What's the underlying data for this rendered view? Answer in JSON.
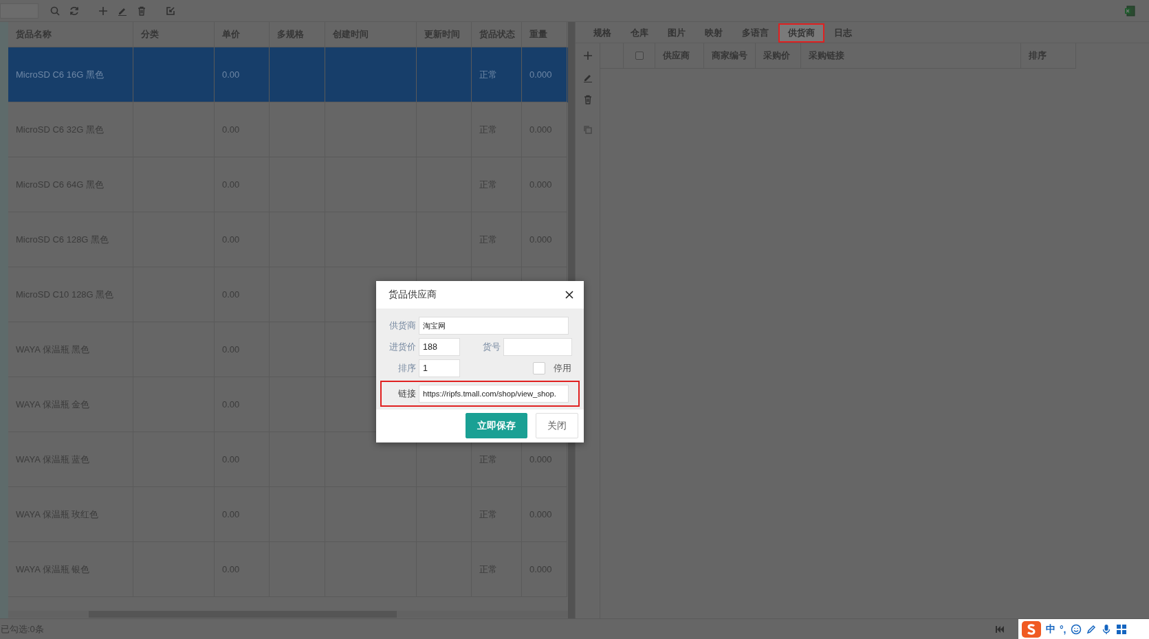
{
  "table": {
    "columns": [
      "货品名称",
      "分类",
      "单价",
      "多规格",
      "创建时间",
      "更新时间",
      "货品状态",
      "重量"
    ],
    "rows": [
      {
        "selected": true,
        "name": "MicroSD C6 16G 黑色",
        "price": "0.00",
        "status": "正常",
        "weight": "0.000"
      },
      {
        "selected": false,
        "name": "MicroSD C6 32G 黑色",
        "price": "0.00",
        "status": "正常",
        "weight": "0.000"
      },
      {
        "selected": false,
        "name": "MicroSD C6 64G 黑色",
        "price": "0.00",
        "status": "正常",
        "weight": "0.000"
      },
      {
        "selected": false,
        "name": "MicroSD C6 128G 黑色",
        "price": "0.00",
        "status": "正常",
        "weight": "0.000"
      },
      {
        "selected": false,
        "name": "MicroSD C10 128G 黑色",
        "price": "0.00"
      },
      {
        "selected": false,
        "name": "WAYA 保温瓶 黑色",
        "price": "0.00"
      },
      {
        "selected": false,
        "name": "WAYA 保温瓶 金色",
        "price": "0.00"
      },
      {
        "selected": false,
        "name": "WAYA 保温瓶 蓝色",
        "price": "0.00",
        "status": "正常",
        "weight": "0.000"
      },
      {
        "selected": false,
        "name": "WAYA 保温瓶 玫红色",
        "price": "0.00",
        "status": "正常",
        "weight": "0.000"
      },
      {
        "selected": false,
        "name": "WAYA 保温瓶 银色",
        "price": "0.00",
        "status": "正常",
        "weight": "0.000"
      }
    ]
  },
  "detail": {
    "tabs": [
      {
        "label": "规格",
        "selected": false,
        "highlighted": false
      },
      {
        "label": "仓库",
        "selected": false,
        "highlighted": false
      },
      {
        "label": "图片",
        "selected": false,
        "highlighted": false
      },
      {
        "label": "映射",
        "selected": false,
        "highlighted": false
      },
      {
        "label": "多语言",
        "selected": false,
        "highlighted": false
      },
      {
        "label": "供货商",
        "selected": true,
        "highlighted": true
      },
      {
        "label": "日志",
        "selected": false,
        "highlighted": false
      }
    ],
    "grid": {
      "select_all": {
        "checked": false
      },
      "columns": [
        "供应商",
        "商家编号",
        "采购价",
        "采购链接",
        "排序"
      ]
    }
  },
  "dialog": {
    "title": "货品供应商",
    "fields": [
      {
        "label": "供货商",
        "value": "淘宝网",
        "highlighted": false
      },
      {
        "label": "进货价",
        "value": "188",
        "highlighted": false
      },
      {
        "label": "货号",
        "highlighted": false
      },
      {
        "label": "排序",
        "value": "1",
        "highlighted": false
      },
      {
        "label": "链接",
        "value": "https://ripfs.tmall.com/shop/view_shop.",
        "highlighted": true
      }
    ],
    "disable_toggle": {
      "label": "停用",
      "checked": false
    },
    "buttons": [
      {
        "label": "立即保存",
        "kind": "primary"
      },
      {
        "label": "关闭",
        "kind": "default"
      }
    ]
  },
  "status_bar": {
    "text": "已勾选:0条"
  },
  "ime_bar": {
    "mode": "中",
    "punctuation": "°,"
  }
}
